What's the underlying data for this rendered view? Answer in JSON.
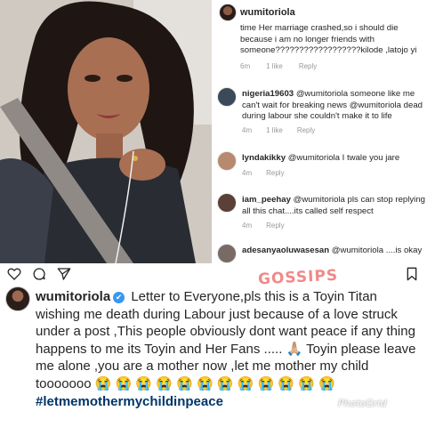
{
  "comments_panel": {
    "username": "wumitoriola",
    "first_comment": {
      "text": "time Her marriage crashed,so i should die because i am no longer friends with someone??????????????????kilode ,latojo yi",
      "time": "6m",
      "likes": "1 like",
      "reply": "Reply"
    },
    "comments": [
      {
        "user": "nigeria19603",
        "text": "@wumitoriola someone like me can't wait for breaking news @wumitoriola dead during labour she couldn't make it to life",
        "time": "4m",
        "likes": "1 like",
        "reply": "Reply",
        "avatar_color": "#3a4a58"
      },
      {
        "user": "lyndakikky",
        "text": "@wumitoriola I twale you jare",
        "time": "4m",
        "likes": "",
        "reply": "Reply",
        "avatar_color": "#b78a6f"
      },
      {
        "user": "iam_peehay",
        "text": "@wumitoriola pls  can stop replying all this chat....its called self respect",
        "time": "4m",
        "likes": "",
        "reply": "Reply",
        "avatar_color": "#5b4038"
      },
      {
        "user": "adesanyaoluwasesan",
        "text": "@wumitoriola ....is okay",
        "time": "",
        "likes": "",
        "reply": "",
        "avatar_color": "#7a6a66"
      }
    ]
  },
  "post": {
    "username": "wumitoriola",
    "verified_mark": "✔",
    "caption": "Letter to Everyone,pls this is a Toyin Titan wishing me death  during Labour just because of a love struck under a post ,This people obviously dont want peace if any thing happens to me its Toyin and Her Fans ..... 🙏🏼 Toyin please leave me alone ,you are a mother now ,let me mother my child tooooooo 😭 😭 😭 😭 😭 😭 😭 😭 😭 😭 😭",
    "emoji_lead": "😭",
    "hashtag": "#letmemothermychildinpeace",
    "icons": [
      "heart-icon",
      "comment-icon",
      "share-icon",
      "bookmark-icon"
    ]
  },
  "watermarks": {
    "red": "GOSSIPS",
    "bottom": "PhotoGrid"
  },
  "colors": {
    "username_text": "#262626",
    "meta_text": "#999999",
    "verified_badge": "#3897f0",
    "hashtag": "#003569"
  }
}
